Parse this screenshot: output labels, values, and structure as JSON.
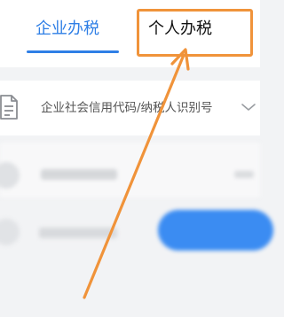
{
  "tabs": {
    "company_label": "企业办税",
    "personal_label": "个人办税"
  },
  "form": {
    "id_field_placeholder": "企业社会信用代码/纳税人识别号"
  },
  "icons": {
    "id_field": "document-icon",
    "dropdown": "chevron-down-icon",
    "pointer": "orange-arrow"
  },
  "colors": {
    "accent": "#2f7fe6",
    "annotation": "#f0933a",
    "button": "#3b8cf2"
  }
}
